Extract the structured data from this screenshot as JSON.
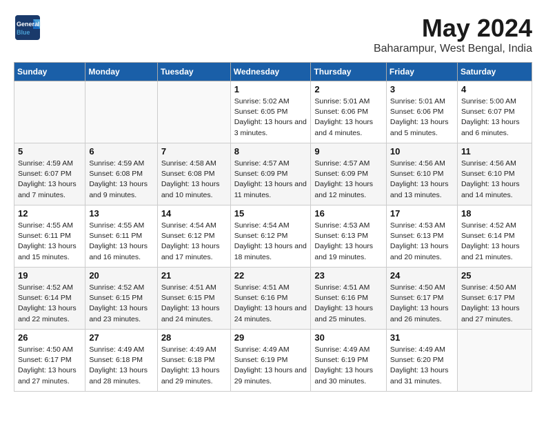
{
  "header": {
    "logo_general": "General",
    "logo_blue": "Blue",
    "month_year": "May 2024",
    "location": "Baharampur, West Bengal, India"
  },
  "days_of_week": [
    "Sunday",
    "Monday",
    "Tuesday",
    "Wednesday",
    "Thursday",
    "Friday",
    "Saturday"
  ],
  "weeks": [
    [
      {
        "day": "",
        "content": ""
      },
      {
        "day": "",
        "content": ""
      },
      {
        "day": "",
        "content": ""
      },
      {
        "day": "1",
        "content": "Sunrise: 5:02 AM\nSunset: 6:05 PM\nDaylight: 13 hours and 3 minutes."
      },
      {
        "day": "2",
        "content": "Sunrise: 5:01 AM\nSunset: 6:06 PM\nDaylight: 13 hours and 4 minutes."
      },
      {
        "day": "3",
        "content": "Sunrise: 5:01 AM\nSunset: 6:06 PM\nDaylight: 13 hours and 5 minutes."
      },
      {
        "day": "4",
        "content": "Sunrise: 5:00 AM\nSunset: 6:07 PM\nDaylight: 13 hours and 6 minutes."
      }
    ],
    [
      {
        "day": "5",
        "content": "Sunrise: 4:59 AM\nSunset: 6:07 PM\nDaylight: 13 hours and 7 minutes."
      },
      {
        "day": "6",
        "content": "Sunrise: 4:59 AM\nSunset: 6:08 PM\nDaylight: 13 hours and 9 minutes."
      },
      {
        "day": "7",
        "content": "Sunrise: 4:58 AM\nSunset: 6:08 PM\nDaylight: 13 hours and 10 minutes."
      },
      {
        "day": "8",
        "content": "Sunrise: 4:57 AM\nSunset: 6:09 PM\nDaylight: 13 hours and 11 minutes."
      },
      {
        "day": "9",
        "content": "Sunrise: 4:57 AM\nSunset: 6:09 PM\nDaylight: 13 hours and 12 minutes."
      },
      {
        "day": "10",
        "content": "Sunrise: 4:56 AM\nSunset: 6:10 PM\nDaylight: 13 hours and 13 minutes."
      },
      {
        "day": "11",
        "content": "Sunrise: 4:56 AM\nSunset: 6:10 PM\nDaylight: 13 hours and 14 minutes."
      }
    ],
    [
      {
        "day": "12",
        "content": "Sunrise: 4:55 AM\nSunset: 6:11 PM\nDaylight: 13 hours and 15 minutes."
      },
      {
        "day": "13",
        "content": "Sunrise: 4:55 AM\nSunset: 6:11 PM\nDaylight: 13 hours and 16 minutes."
      },
      {
        "day": "14",
        "content": "Sunrise: 4:54 AM\nSunset: 6:12 PM\nDaylight: 13 hours and 17 minutes."
      },
      {
        "day": "15",
        "content": "Sunrise: 4:54 AM\nSunset: 6:12 PM\nDaylight: 13 hours and 18 minutes."
      },
      {
        "day": "16",
        "content": "Sunrise: 4:53 AM\nSunset: 6:13 PM\nDaylight: 13 hours and 19 minutes."
      },
      {
        "day": "17",
        "content": "Sunrise: 4:53 AM\nSunset: 6:13 PM\nDaylight: 13 hours and 20 minutes."
      },
      {
        "day": "18",
        "content": "Sunrise: 4:52 AM\nSunset: 6:14 PM\nDaylight: 13 hours and 21 minutes."
      }
    ],
    [
      {
        "day": "19",
        "content": "Sunrise: 4:52 AM\nSunset: 6:14 PM\nDaylight: 13 hours and 22 minutes."
      },
      {
        "day": "20",
        "content": "Sunrise: 4:52 AM\nSunset: 6:15 PM\nDaylight: 13 hours and 23 minutes."
      },
      {
        "day": "21",
        "content": "Sunrise: 4:51 AM\nSunset: 6:15 PM\nDaylight: 13 hours and 24 minutes."
      },
      {
        "day": "22",
        "content": "Sunrise: 4:51 AM\nSunset: 6:16 PM\nDaylight: 13 hours and 24 minutes."
      },
      {
        "day": "23",
        "content": "Sunrise: 4:51 AM\nSunset: 6:16 PM\nDaylight: 13 hours and 25 minutes."
      },
      {
        "day": "24",
        "content": "Sunrise: 4:50 AM\nSunset: 6:17 PM\nDaylight: 13 hours and 26 minutes."
      },
      {
        "day": "25",
        "content": "Sunrise: 4:50 AM\nSunset: 6:17 PM\nDaylight: 13 hours and 27 minutes."
      }
    ],
    [
      {
        "day": "26",
        "content": "Sunrise: 4:50 AM\nSunset: 6:17 PM\nDaylight: 13 hours and 27 minutes."
      },
      {
        "day": "27",
        "content": "Sunrise: 4:49 AM\nSunset: 6:18 PM\nDaylight: 13 hours and 28 minutes."
      },
      {
        "day": "28",
        "content": "Sunrise: 4:49 AM\nSunset: 6:18 PM\nDaylight: 13 hours and 29 minutes."
      },
      {
        "day": "29",
        "content": "Sunrise: 4:49 AM\nSunset: 6:19 PM\nDaylight: 13 hours and 29 minutes."
      },
      {
        "day": "30",
        "content": "Sunrise: 4:49 AM\nSunset: 6:19 PM\nDaylight: 13 hours and 30 minutes."
      },
      {
        "day": "31",
        "content": "Sunrise: 4:49 AM\nSunset: 6:20 PM\nDaylight: 13 hours and 31 minutes."
      },
      {
        "day": "",
        "content": ""
      }
    ]
  ]
}
